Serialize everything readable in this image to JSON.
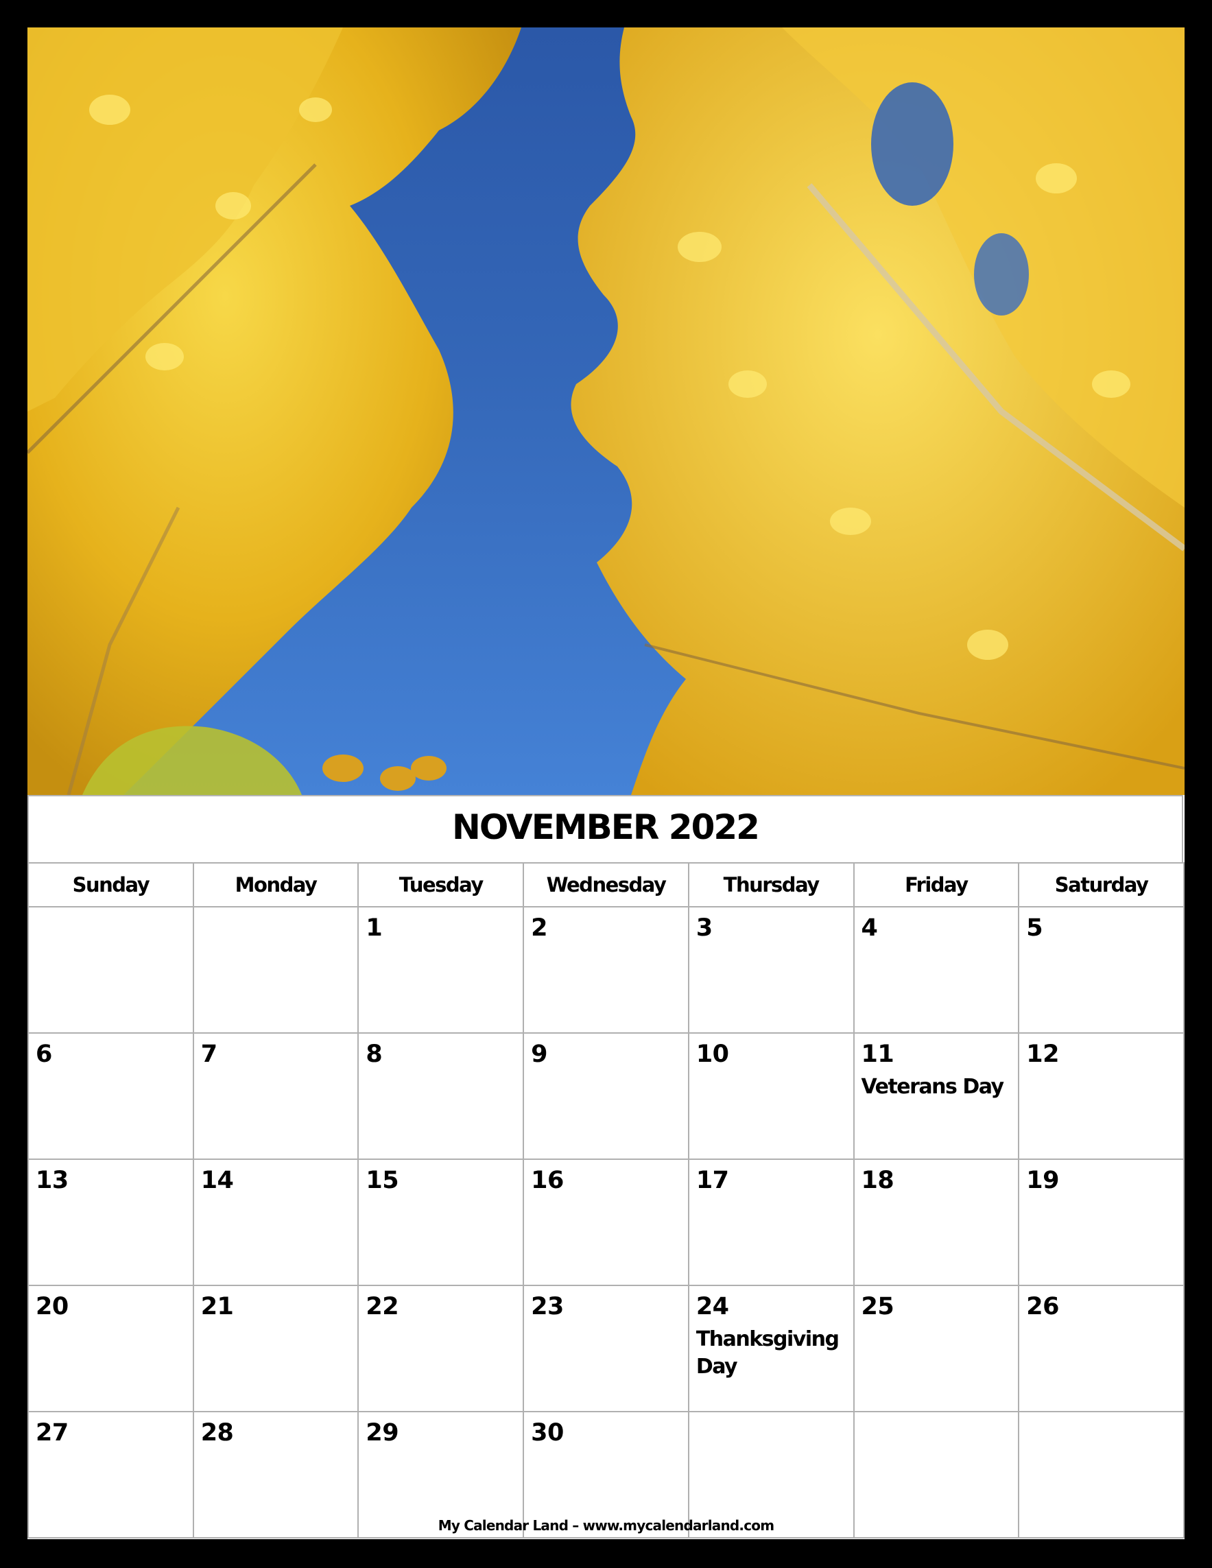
{
  "calendar": {
    "title": "NOVEMBER 2022",
    "weekdays": [
      "Sunday",
      "Monday",
      "Tuesday",
      "Wednesday",
      "Thursday",
      "Friday",
      "Saturday"
    ],
    "weeks": [
      [
        {
          "day": ""
        },
        {
          "day": ""
        },
        {
          "day": "1"
        },
        {
          "day": "2"
        },
        {
          "day": "3"
        },
        {
          "day": "4"
        },
        {
          "day": "5"
        }
      ],
      [
        {
          "day": "6"
        },
        {
          "day": "7"
        },
        {
          "day": "8"
        },
        {
          "day": "9"
        },
        {
          "day": "10"
        },
        {
          "day": "11",
          "holiday": "Veterans Day"
        },
        {
          "day": "12"
        }
      ],
      [
        {
          "day": "13"
        },
        {
          "day": "14"
        },
        {
          "day": "15"
        },
        {
          "day": "16"
        },
        {
          "day": "17"
        },
        {
          "day": "18"
        },
        {
          "day": "19"
        }
      ],
      [
        {
          "day": "20"
        },
        {
          "day": "21"
        },
        {
          "day": "22"
        },
        {
          "day": "23"
        },
        {
          "day": "24",
          "holiday": "Thanksgiving Day"
        },
        {
          "day": "25"
        },
        {
          "day": "26"
        }
      ],
      [
        {
          "day": "27"
        },
        {
          "day": "28"
        },
        {
          "day": "29"
        },
        {
          "day": "30"
        },
        {
          "day": ""
        },
        {
          "day": ""
        },
        {
          "day": ""
        }
      ]
    ]
  },
  "photo": {
    "subject": "yellow autumn aspen leaves against blue sky",
    "colors": {
      "sky": "#3467b8",
      "foliage": "#e8b820",
      "foliage_light": "#f5d040",
      "branch": "#8a6a3a"
    }
  },
  "footer": {
    "text": "My Calendar Land –  www.mycalendarland.com"
  }
}
